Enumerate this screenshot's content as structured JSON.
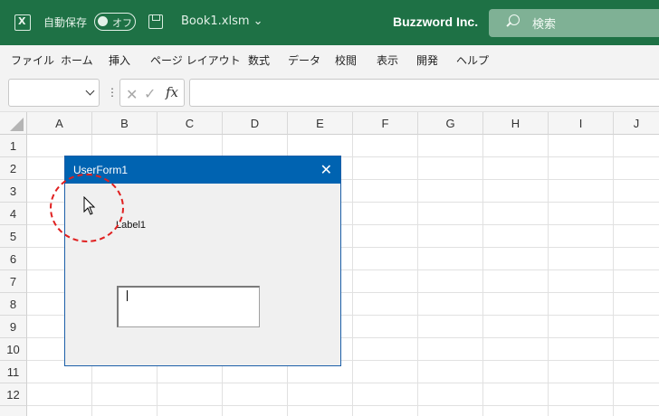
{
  "titlebar": {
    "autosave_label": "自動保存",
    "toggle_state": "オフ",
    "filename": "Book1.xlsm",
    "brand": "Buzzword Inc.",
    "search_placeholder": "検索"
  },
  "menu": [
    "ファイル",
    "ホーム",
    "挿入",
    "ページ レイアウト",
    "数式",
    "データ",
    "校閲",
    "表示",
    "開発",
    "ヘルプ"
  ],
  "formula_bar": {
    "fx_label": "fx",
    "cancel_glyph": "✕",
    "enter_glyph": "✓",
    "separator": "⋮"
  },
  "columns": [
    "A",
    "B",
    "C",
    "D",
    "E",
    "F",
    "G",
    "H",
    "I",
    "J"
  ],
  "rows": [
    "1",
    "2",
    "3",
    "4",
    "5",
    "6",
    "7",
    "8",
    "9",
    "10",
    "11",
    "12"
  ],
  "userform": {
    "title": "UserForm1",
    "close_glyph": "✕",
    "label": "Label1"
  },
  "colors": {
    "titlebar_bg": "#1e7145",
    "userform_title_bg": "#0063b1",
    "highlight": "#e02020"
  }
}
